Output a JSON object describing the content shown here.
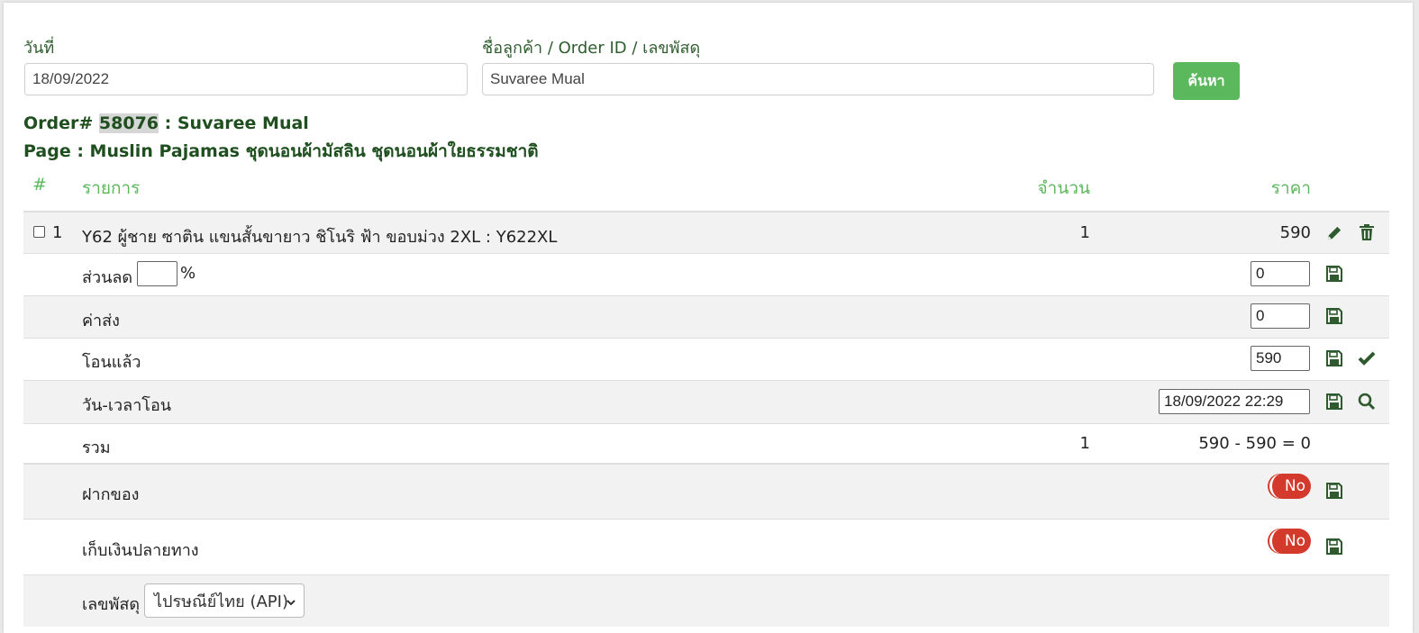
{
  "filters": {
    "date_label": "วันที่",
    "date_value": "18/09/2022",
    "customer_label": "ชื่อลูกค้า / Order ID / เลขพัสดุ",
    "customer_value": "Suvaree Mual",
    "search_label": "ค้นหา"
  },
  "order": {
    "prefix": "Order# ",
    "id": "58076",
    "customer": " : Suvaree Mual",
    "page_line": "Page : Muslin Pajamas ชุดนอนผ้ามัสลิน ชุดนอนผ้าใยธรรมชาติ"
  },
  "table": {
    "headers": {
      "num": "#",
      "item": "รายการ",
      "qty": "จำนวน",
      "price": "ราคา"
    },
    "item": {
      "no": "1",
      "name": "Y62 ผู้ชาย ซาติน แขนสั้นขายาว ชิโนริ ฟ้า ขอบม่วง 2XL : Y622XL",
      "qty": "1",
      "price": "590"
    },
    "discount": {
      "label": "ส่วนลด",
      "percent_value": "",
      "percent_sign": "%",
      "amount": "0"
    },
    "shipping": {
      "label": "ค่าส่ง",
      "amount": "0"
    },
    "transferred": {
      "label": "โอนแล้ว",
      "amount": "590"
    },
    "transfer_time": {
      "label": "วัน-เวลาโอน",
      "value": "18/09/2022 22:29"
    },
    "total": {
      "label": "รวม",
      "qty": "1",
      "value": "590 - 590 = 0"
    },
    "deposit": {
      "label": "ฝากของ",
      "toggle": "No"
    },
    "cod": {
      "label": "เก็บเงินปลายทาง",
      "toggle": "No"
    },
    "tracking": {
      "label": "เลขพัสดุ",
      "carrier": "ไปรษณีย์ไทย (API)"
    }
  },
  "colors": {
    "accent_green": "#5cb85c",
    "title_green": "#1f4f1f",
    "toggle_red": "#d33a2c",
    "icon_green": "#2e5a2e"
  }
}
